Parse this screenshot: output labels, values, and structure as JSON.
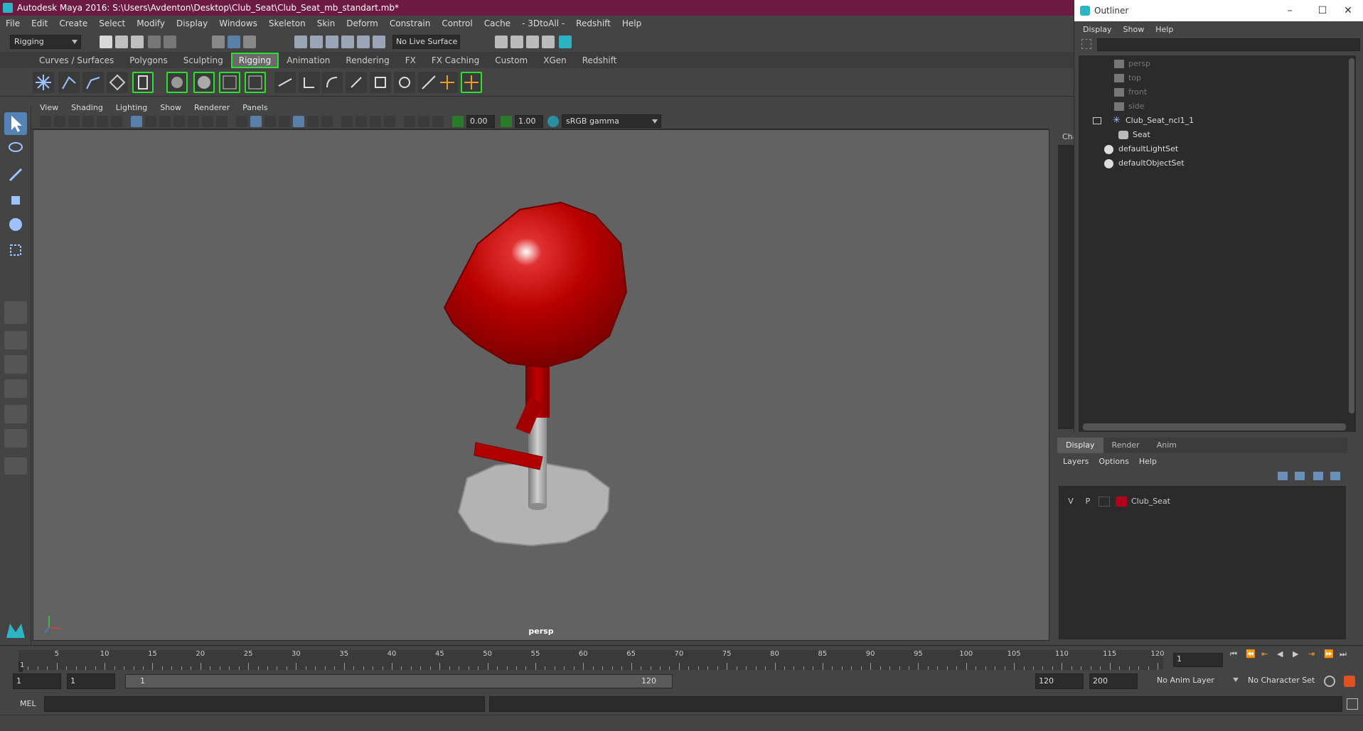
{
  "window": {
    "title": "Autodesk Maya 2016: S:\\Users\\Avdenton\\Desktop\\Club_Seat\\Club_Seat_mb_standart.mb*"
  },
  "menubar": [
    "File",
    "Edit",
    "Create",
    "Select",
    "Modify",
    "Display",
    "Windows",
    "Skeleton",
    "Skin",
    "Deform",
    "Constrain",
    "Control",
    "Cache",
    "- 3DtoAll -",
    "Redshift",
    "Help"
  ],
  "statusline": {
    "mode": "Rigging",
    "live_surface": "No Live Surface"
  },
  "shelf_tabs": [
    "Curves / Surfaces",
    "Polygons",
    "Sculpting",
    "Rigging",
    "Animation",
    "Rendering",
    "FX",
    "FX Caching",
    "Custom",
    "XGen",
    "Redshift"
  ],
  "shelf_active": "Rigging",
  "panel_menu": [
    "View",
    "Shading",
    "Lighting",
    "Show",
    "Renderer",
    "Panels"
  ],
  "panel_toolbar": {
    "exposure": "0.00",
    "gamma": "1.00",
    "color_space": "sRGB gamma"
  },
  "viewport": {
    "camera_label": "persp",
    "bg_color": "#626262",
    "seat_color": "#b50000",
    "base_color": "#b3b3b3"
  },
  "channel_box": {
    "label": "Cha"
  },
  "outliner": {
    "title": "Outliner",
    "menu": [
      "Display",
      "Show",
      "Help"
    ],
    "items": [
      {
        "label": "persp",
        "dim": true
      },
      {
        "label": "top",
        "dim": true
      },
      {
        "label": "front",
        "dim": true
      },
      {
        "label": "side",
        "dim": true
      },
      {
        "label": "Club_Seat_ncl1_1",
        "dim": false
      },
      {
        "label": "Seat",
        "dim": false
      },
      {
        "label": "defaultLightSet",
        "dim": false
      },
      {
        "label": "defaultObjectSet",
        "dim": false
      }
    ]
  },
  "layer_editor": {
    "tabs": [
      "Display",
      "Render",
      "Anim"
    ],
    "active_tab": "Display",
    "menu": [
      "Layers",
      "Options",
      "Help"
    ],
    "layers": [
      {
        "v": "V",
        "p": "P",
        "name": "Club_Seat",
        "color": "#b3001b"
      }
    ]
  },
  "timeline": {
    "ticks": [
      5,
      10,
      15,
      20,
      25,
      30,
      35,
      40,
      45,
      50,
      55,
      60,
      65,
      70,
      75,
      80,
      85,
      90,
      95,
      100,
      105,
      110,
      115,
      120
    ],
    "current_frame_mark": "1",
    "current_frame_field": "1"
  },
  "range": {
    "start": "1",
    "start2": "1",
    "range_start_label": "1",
    "range_end_label": "120",
    "end": "120",
    "max": "200",
    "anim_layer": "No Anim Layer",
    "char_set": "No Character Set"
  },
  "cmdline": {
    "label": "MEL"
  }
}
